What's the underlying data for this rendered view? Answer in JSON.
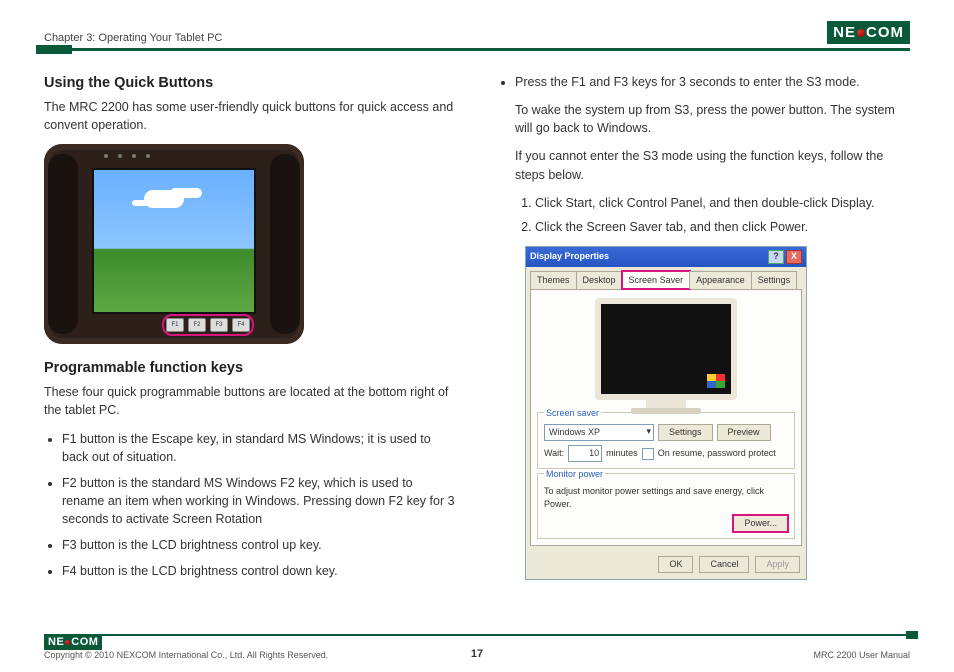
{
  "brand": {
    "pre": "NE",
    "post": "COM"
  },
  "header": {
    "chapter": "Chapter 3: Operating Your Tablet PC"
  },
  "left": {
    "h_quick": "Using the Quick Buttons",
    "p_quick": "The MRC 2200 has some user-friendly quick buttons for quick access and convent operation.",
    "tablet_fn": [
      "F1",
      "F2",
      "F3",
      "F4"
    ],
    "h_prog": "Programmable function keys",
    "p_prog": "These four quick programmable buttons are located at the bottom right of the tablet PC.",
    "bullets": [
      "F1 button is the Escape key, in standard MS Windows; it is used to back out of situation.",
      "F2 button is the standard MS Windows F2 key, which is used to rename an item when working in Windows. Pressing down F2 key for 3 seconds to activate Screen Rotation",
      "F3 button is the LCD brightness control up key.",
      "F4 button is the LCD brightness control down key."
    ]
  },
  "right": {
    "b_top": "Press the F1 and F3 keys for 3 seconds to enter the S3 mode.",
    "p_wake": "To wake the system up from S3, press the power button. The system will go back to Windows.",
    "p_if": "If you cannot enter the S3 mode using the function keys, follow the steps below.",
    "steps": [
      "Click Start, click Control Panel, and then double-click Display.",
      "Click the Screen Saver tab, and then click Power."
    ],
    "dialog": {
      "title": "Display Properties",
      "help": "?",
      "close": "X",
      "tabs": [
        "Themes",
        "Desktop",
        "Screen Saver",
        "Appearance",
        "Settings"
      ],
      "active_tab_index": 2,
      "saver_legend": "Screen saver",
      "saver_value": "Windows XP",
      "settings_btn": "Settings",
      "preview_btn": "Preview",
      "wait_lbl": "Wait:",
      "wait_val": "10",
      "wait_unit": "minutes",
      "resume_lbl": "On resume, password protect",
      "monitor_legend": "Monitor power",
      "monitor_text": "To adjust monitor power settings and save energy, click Power.",
      "power_btn": "Power...",
      "ok": "OK",
      "cancel": "Cancel",
      "apply": "Apply"
    }
  },
  "footer": {
    "copyright": "Copyright © 2010 NEXCOM International Co., Ltd. All Rights Reserved.",
    "page": "17",
    "doc": "MRC 2200 User Manual"
  }
}
